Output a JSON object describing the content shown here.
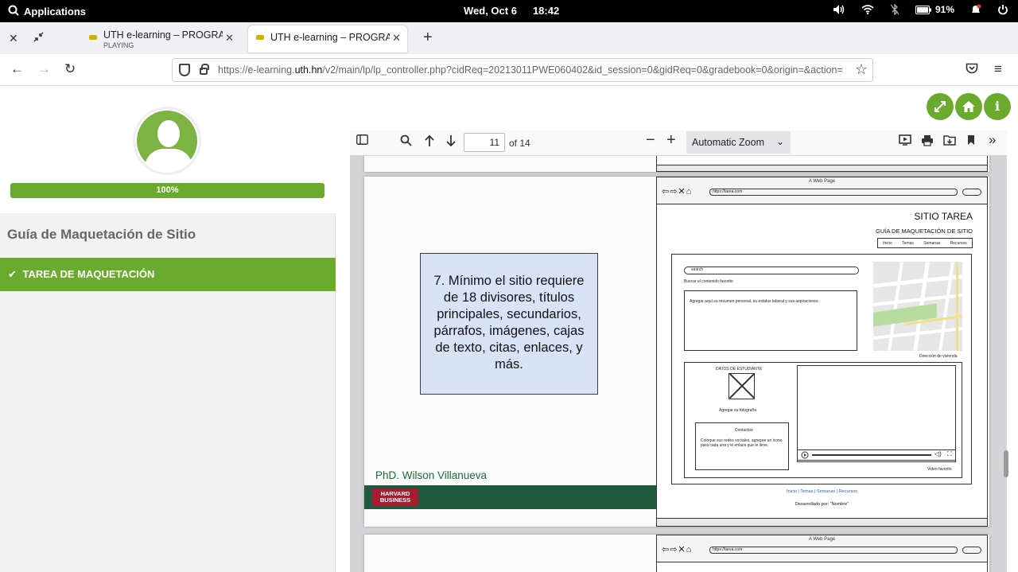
{
  "system_bar": {
    "apps_label": "Applications",
    "date": "Wed, Oct  6",
    "time": "18:42",
    "battery": "91%"
  },
  "tabs": [
    {
      "title": "UTH e-learning – PROGRAMA",
      "subtitle": "PLAYING"
    },
    {
      "title": "UTH e-learning – PROGRAMA"
    }
  ],
  "address": {
    "url_prefix": "https://e-learning.",
    "url_domain": "uth.hn",
    "url_rest": "/v2/main/lp/lp_controller.php?cidReq=20213011PWE060402&id_session=0&gidReq=0&gradebook=0&origin=&action="
  },
  "sidebar": {
    "progress_label": "100%",
    "progress_value": 1.0,
    "title": "Guía de Maquetación de Sitio",
    "item_label": "TAREA DE MAQUETACIÓN"
  },
  "pdf": {
    "page_current": "11",
    "page_total_label": "of 14",
    "zoom_label": "Automatic Zoom"
  },
  "slide": {
    "note_text": "7. Mínimo el sitio requiere de 18 divisores, títulos principales, secundarios, párrafos, imágenes, cajas de texto, citas, enlaces, y más.",
    "author": "PhD. Wilson Villanueva",
    "logo_text": "HARVARD BUSINESS"
  },
  "wireframe": {
    "window_title": "A Web Page",
    "address": "https://tarea.com",
    "site_title": "SITIO TAREA",
    "site_subtitle": "GUÍA DE MAQUETACIÓN DE SITIO",
    "menu": [
      "Inicio",
      "Temas",
      "Semanas",
      "Recursos"
    ],
    "search_placeholder": "search",
    "search_caption": "Buscar el contenido favorito",
    "summary_text": "Agregar aquí su resumen personal, su estatus laboral y sus aspiraciones.",
    "map_caption": "Dirección de vivienda",
    "student_header": "DATOS DE ESTUDIANTE",
    "photo_caption": "Agregar su fotografía",
    "contacts_title": "Contactos",
    "contacts_text": "Coloque sus redes sociales, agregue un icono para cada una y el enlace que le lleve.",
    "video_caption": "Video favorito",
    "footer_links": "Inicio | Temas | Semanas | Recursos",
    "footer_credit": "Desarrollado por: \"Nombre\""
  }
}
